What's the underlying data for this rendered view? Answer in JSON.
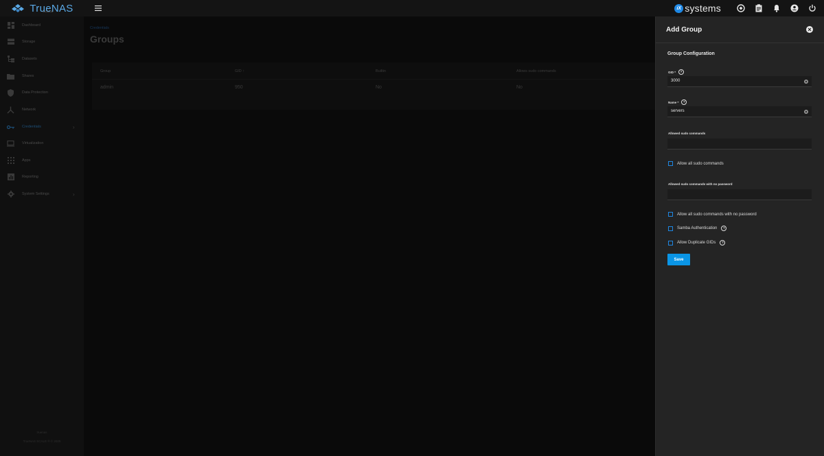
{
  "brand": {
    "name": "TrueNAS",
    "sub": "SCALE"
  },
  "header": {
    "vendor": "systems",
    "vendor_badge": "iX"
  },
  "nav": [
    {
      "label": "Dashboard",
      "icon": "dashboard-icon"
    },
    {
      "label": "Storage",
      "icon": "storage-icon"
    },
    {
      "label": "Datasets",
      "icon": "datasets-icon"
    },
    {
      "label": "Shares",
      "icon": "shares-icon"
    },
    {
      "label": "Data Protection",
      "icon": "shield-icon"
    },
    {
      "label": "Network",
      "icon": "network-icon"
    },
    {
      "label": "Credentials",
      "icon": "key-icon"
    },
    {
      "label": "Virtualization",
      "icon": "laptop-icon"
    },
    {
      "label": "Apps",
      "icon": "apps-grid-icon"
    },
    {
      "label": "Reporting",
      "icon": "chart-icon"
    },
    {
      "label": "System Settings",
      "icon": "gear-icon"
    }
  ],
  "sidebar_footer": {
    "hostname": "truenas",
    "copyright": "TrueNAS SCALE ® © 2025"
  },
  "main": {
    "breadcrumb": "Credentials",
    "title": "Groups",
    "table": {
      "columns": [
        "Group",
        "GID",
        "Builtin",
        "Allows sudo commands"
      ],
      "rows": [
        [
          "admin",
          "950",
          "No",
          "No"
        ]
      ]
    }
  },
  "panel": {
    "title": "Add Group",
    "section": "Group Configuration",
    "gid_label": "GID *",
    "gid_value": "3000",
    "name_label": "Name *",
    "name_value": "servers",
    "sudo_label": "Allowed sudo commands",
    "allow_all_sudo": "Allow all sudo commands",
    "sudo_nopass_label": "Allowed sudo commands with no password",
    "allow_all_nopass": "Allow all sudo commands with no password",
    "samba_auth": "Samba Authentication",
    "allow_dup_gids": "Allow Duplicate GIDs",
    "save": "Save",
    "help_glyph": "?"
  }
}
